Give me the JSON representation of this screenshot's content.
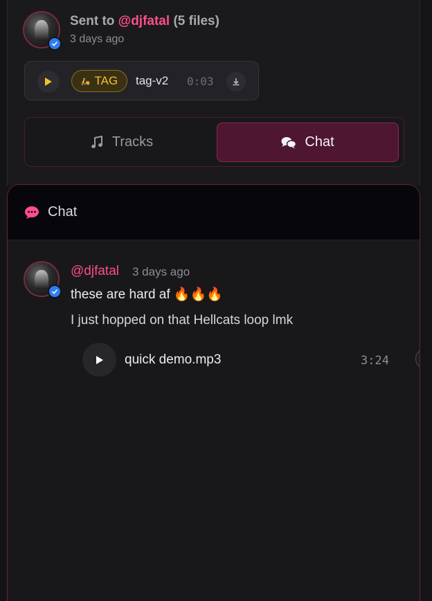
{
  "header": {
    "sent_prefix": "Sent to",
    "handle": "@djfatal",
    "files_count": "(5 files)",
    "time": "3 days ago"
  },
  "file": {
    "tag_label": "TAG",
    "name": "tag-v2",
    "duration": "0:03"
  },
  "tabs": [
    {
      "label": "Tracks",
      "icon": "music-note-icon",
      "active": false
    },
    {
      "label": "Chat",
      "icon": "chat-bubbles-icon",
      "active": true
    }
  ],
  "chat": {
    "title": "Chat",
    "message": {
      "handle": "@djfatal",
      "time": "3 days ago",
      "line1": "these are hard af 🔥🔥🔥",
      "line2": "I just hopped on that Hellcats loop lmk",
      "attachment": {
        "name": "quick demo.mp3",
        "duration": "3:24"
      }
    }
  },
  "colors": {
    "accent": "#ff4d8f",
    "tag": "#f5c02e",
    "verified": "#2f7df6",
    "active_tab": "#4e1630"
  }
}
